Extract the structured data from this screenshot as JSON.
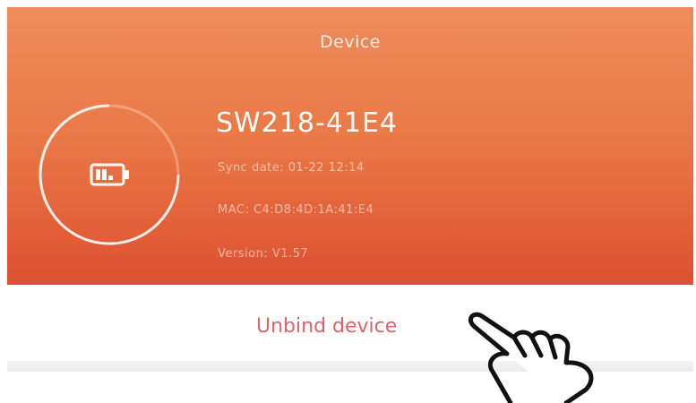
{
  "header": {
    "title": "Device"
  },
  "device": {
    "name": "SW218-41E4",
    "sync_date": "Sync date: 01-22 12:14",
    "mac": "MAC: C4:D8:4D:1A:41:E4",
    "version": "Version: V1.57"
  },
  "actions": {
    "unbind_label": "Unbind device"
  },
  "icons": {
    "battery": "battery-low-icon",
    "pointer": "hand-pointer-icon"
  },
  "colors": {
    "accent": "#e8723f",
    "unbind_text": "#d9646a"
  }
}
